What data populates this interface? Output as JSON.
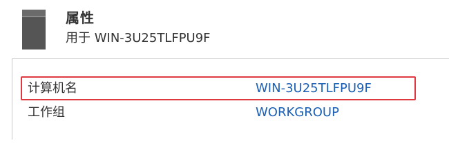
{
  "header": {
    "title": "属性",
    "subtitle": "用于 WIN-3U25TLFPU9F",
    "icon": "server-icon"
  },
  "properties": [
    {
      "label": "计算机名",
      "value": "WIN-3U25TLFPU9F"
    },
    {
      "label": "工作组",
      "value": "WORKGROUP"
    }
  ],
  "colors": {
    "link": "#1a5fb4",
    "highlight": "#e0383f",
    "text": "#333333"
  }
}
